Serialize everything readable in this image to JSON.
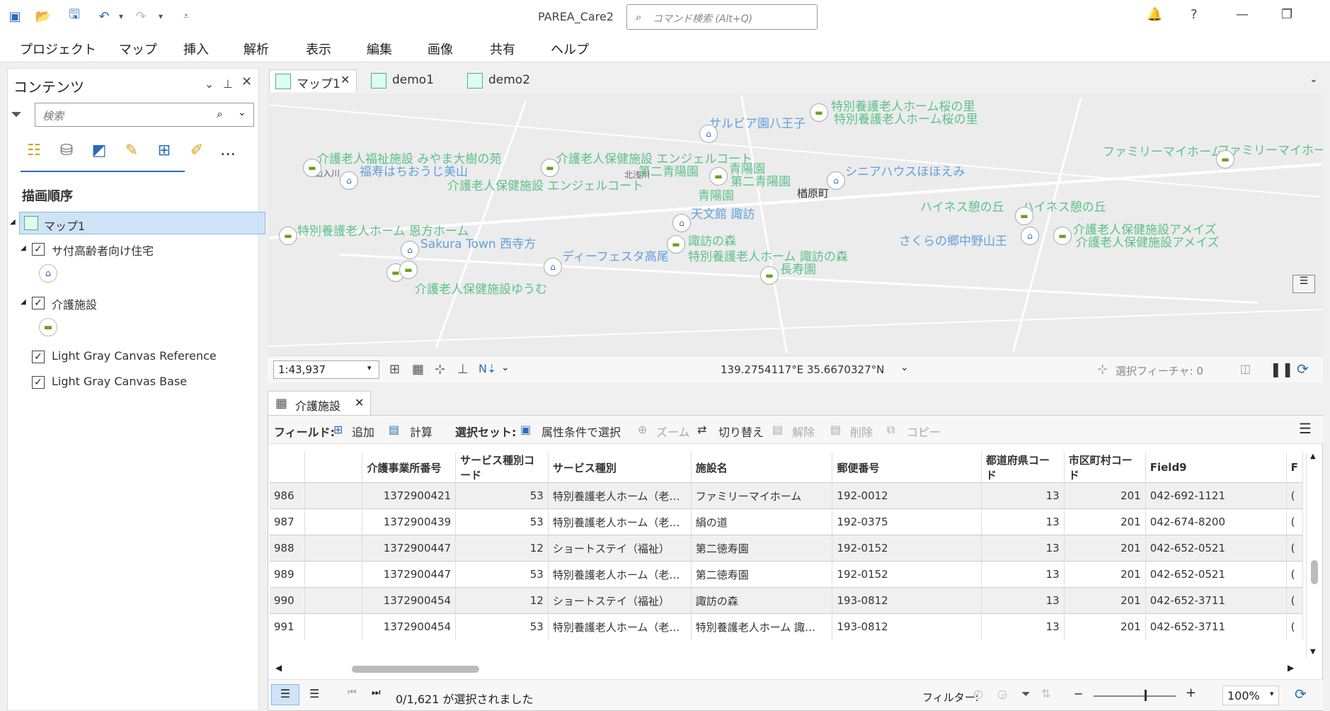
{
  "app": {
    "title": "PAREA_Care2",
    "command_search_placeholder": "コマンド検索 (Alt+Q)"
  },
  "menu": [
    "プロジェクト",
    "マップ",
    "挿入",
    "解析",
    "表示",
    "編集",
    "画像",
    "共有",
    "ヘルプ"
  ],
  "contents": {
    "title": "コンテンツ",
    "search_placeholder": "検索",
    "draw_order_label": "描画順序",
    "layers": {
      "map": "マップ1",
      "housing": "サ付高齢者向け住宅",
      "care": "介護施設",
      "ref": "Light Gray Canvas Reference",
      "base": "Light Gray Canvas Base"
    }
  },
  "map_tabs": [
    "マップ1",
    "demo1",
    "demo2"
  ],
  "map_labels": {
    "l1": "特別養護老人ホーム桜の里",
    "l2": "特別養護老人ホーム桜の里",
    "l3": "サルビア園八王子",
    "l4": "介護老人福祉施設 みやま大樹の苑",
    "l5": "福寿はちおうじ美山",
    "l6": "介護老人保健施設 エンジェルコート",
    "l7": "第二青陽園",
    "l8": "青陽園",
    "l9": "第二青陽園",
    "l10": "介護老人保健施設 エンジェルコート",
    "l11": "青陽園",
    "l12": "シニアハウスほほえみ",
    "l13": "楢原町",
    "l14": "ファミリーマイホーム",
    "l15": "ファミリーマイホーム",
    "l16": "ハイネス憩の丘",
    "l17": "ハイネス憩の丘",
    "l18": "天文館 諏訪",
    "l19": "特別養護老人ホーム 恩方ホーム",
    "l20": "Sakura Town 西寺方",
    "l21": "諏訪の森",
    "l22": "さくらの郷中野山王",
    "l23": "介護老人保健施設アメイズ",
    "l24": "介護老人保健施設アメイズ",
    "l25": "ディーフェスタ高尾",
    "l26": "特別養護老人ホーム 諏訪の森",
    "l27": "長寿園",
    "l28": "介護老人保健施設ゆうむ",
    "l29": "山入川",
    "l30": "北浅川"
  },
  "map_status": {
    "scale": "1:43,937",
    "coords": "139.2754117°E 35.6670327°N",
    "selected": "選択フィーチャ: 0"
  },
  "table": {
    "tab_label": "介護施設",
    "toolbar": {
      "field_label": "フィールド:",
      "add": "追加",
      "calc": "計算",
      "selset_label": "選択セット:",
      "select_by_attr": "属性条件で選択",
      "zoom": "ズーム",
      "switch": "切り替え",
      "clear": "解除",
      "delete": "削除",
      "copy": "コピー"
    },
    "columns": [
      "",
      "",
      "介護事業所番号",
      "サービス種別コード",
      "サービス種別",
      "施設名",
      "郵便番号",
      "都道府県コード",
      "市区町村コード",
      "Field9",
      "F"
    ],
    "rows": [
      [
        "986",
        "",
        "1372900421",
        "53",
        "特別養護老人ホーム（老…",
        "ファミリーマイホーム",
        "192-0012",
        "13",
        "201",
        "042-692-1121",
        "("
      ],
      [
        "987",
        "",
        "1372900439",
        "53",
        "特別養護老人ホーム（老…",
        "絹の道",
        "192-0375",
        "13",
        "201",
        "042-674-8200",
        "("
      ],
      [
        "988",
        "",
        "1372900447",
        "12",
        "ショートステイ（福祉）",
        "第二徳寿園",
        "192-0152",
        "13",
        "201",
        "042-652-0521",
        "("
      ],
      [
        "989",
        "",
        "1372900447",
        "53",
        "特別養護老人ホーム（老…",
        "第二徳寿園",
        "192-0152",
        "13",
        "201",
        "042-652-0521",
        "("
      ],
      [
        "990",
        "",
        "1372900454",
        "12",
        "ショートステイ（福祉）",
        "諏訪の森",
        "193-0812",
        "13",
        "201",
        "042-652-3711",
        "("
      ],
      [
        "991",
        "",
        "1372900454",
        "53",
        "特別養護老人ホーム（老…",
        "特別養護老人ホーム 諏…",
        "193-0812",
        "13",
        "201",
        "042-652-3711",
        "("
      ]
    ],
    "footer": {
      "selection": "0/1,621 が選択されました",
      "filter_label": "フィルター:",
      "zoom": "100%"
    }
  }
}
